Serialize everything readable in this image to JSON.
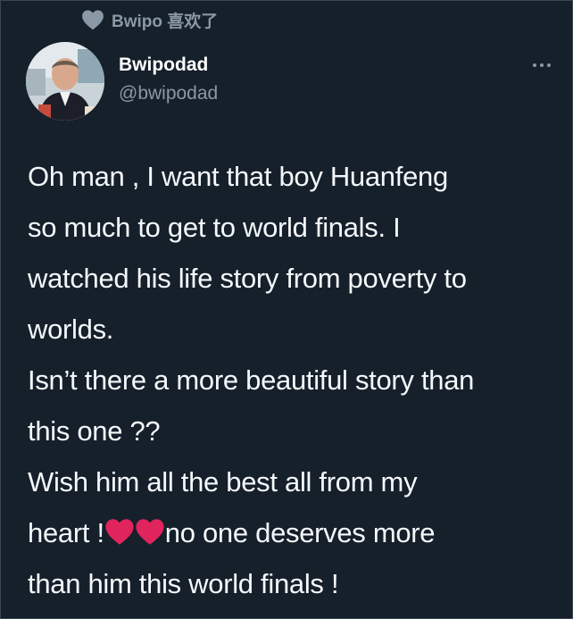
{
  "social_context": {
    "icon": "heart-icon",
    "text": "Bwipo 喜欢了"
  },
  "author": {
    "display_name": "Bwipodad",
    "handle": "@bwipodad",
    "avatar": "profile-photo"
  },
  "more_menu": {
    "icon": "more-horizontal-icon"
  },
  "tweet": {
    "lines": [
      "Oh man , I want that boy Huanfeng",
      "so much to get to world finals. I",
      "watched his life story from poverty to",
      "worlds.",
      "Isn’t there a more beautiful story than",
      "this one ??",
      "Wish him all the best all from my"
    ],
    "line_8_before": "heart !",
    "line_8_after": "no one deserves more",
    "line_9": "than him this world finals !",
    "emoji": [
      "red-heart",
      "red-heart"
    ]
  },
  "colors": {
    "background": "#15202b",
    "secondary_text": "#8b98a5",
    "primary_text": "#f5f8fa",
    "heart": "#e0245e"
  }
}
